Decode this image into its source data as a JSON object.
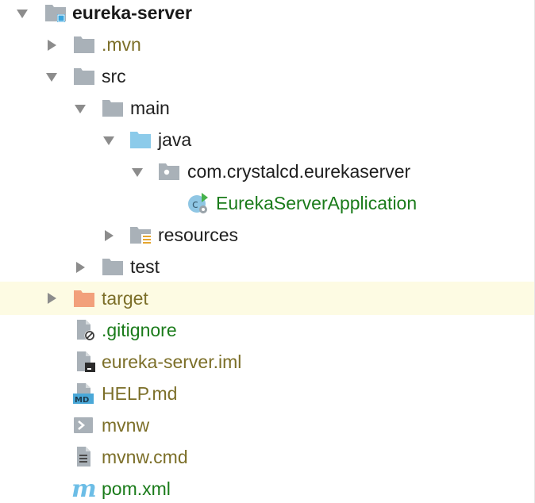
{
  "colors": {
    "folder_gray": "#a9b1b8",
    "folder_blue": "#8ccbea",
    "folder_orange": "#f2a07b",
    "text_default": "#1f1f1f",
    "text_olive": "#7c6f29",
    "text_green": "#1a7b1a",
    "highlight_row": "#fdfbe3",
    "module_badge": "#3aa4dd"
  },
  "tree": {
    "root": {
      "label": "eureka-server",
      "icon": "module-folder-icon",
      "expanded": true
    },
    "mvn": {
      "label": ".mvn",
      "icon": "folder-icon",
      "expanded": false
    },
    "src": {
      "label": "src",
      "icon": "folder-icon",
      "expanded": true
    },
    "main": {
      "label": "main",
      "icon": "folder-icon",
      "expanded": true
    },
    "java": {
      "label": "java",
      "icon": "source-root-folder-icon",
      "expanded": true
    },
    "package": {
      "label": "com.crystalcd.eurekaserver",
      "icon": "package-icon",
      "expanded": true
    },
    "app_class": {
      "label": "EurekaServerApplication",
      "icon": "spring-boot-class-icon"
    },
    "resources": {
      "label": "resources",
      "icon": "resources-folder-icon",
      "expanded": false
    },
    "test": {
      "label": "test",
      "icon": "folder-icon",
      "expanded": false
    },
    "target": {
      "label": "target",
      "icon": "excluded-folder-icon",
      "expanded": false
    },
    "gitignore": {
      "label": ".gitignore",
      "icon": "ignored-file-icon"
    },
    "iml": {
      "label": "eureka-server.iml",
      "icon": "module-file-icon"
    },
    "help": {
      "label": "HELP.md",
      "icon": "markdown-file-icon",
      "badge": "MD"
    },
    "mvnw": {
      "label": "mvnw",
      "icon": "shell-script-icon"
    },
    "mvnw_cmd": {
      "label": "mvnw.cmd",
      "icon": "text-file-icon"
    },
    "pom": {
      "label": "pom.xml",
      "icon": "maven-icon",
      "badge": "m"
    }
  }
}
